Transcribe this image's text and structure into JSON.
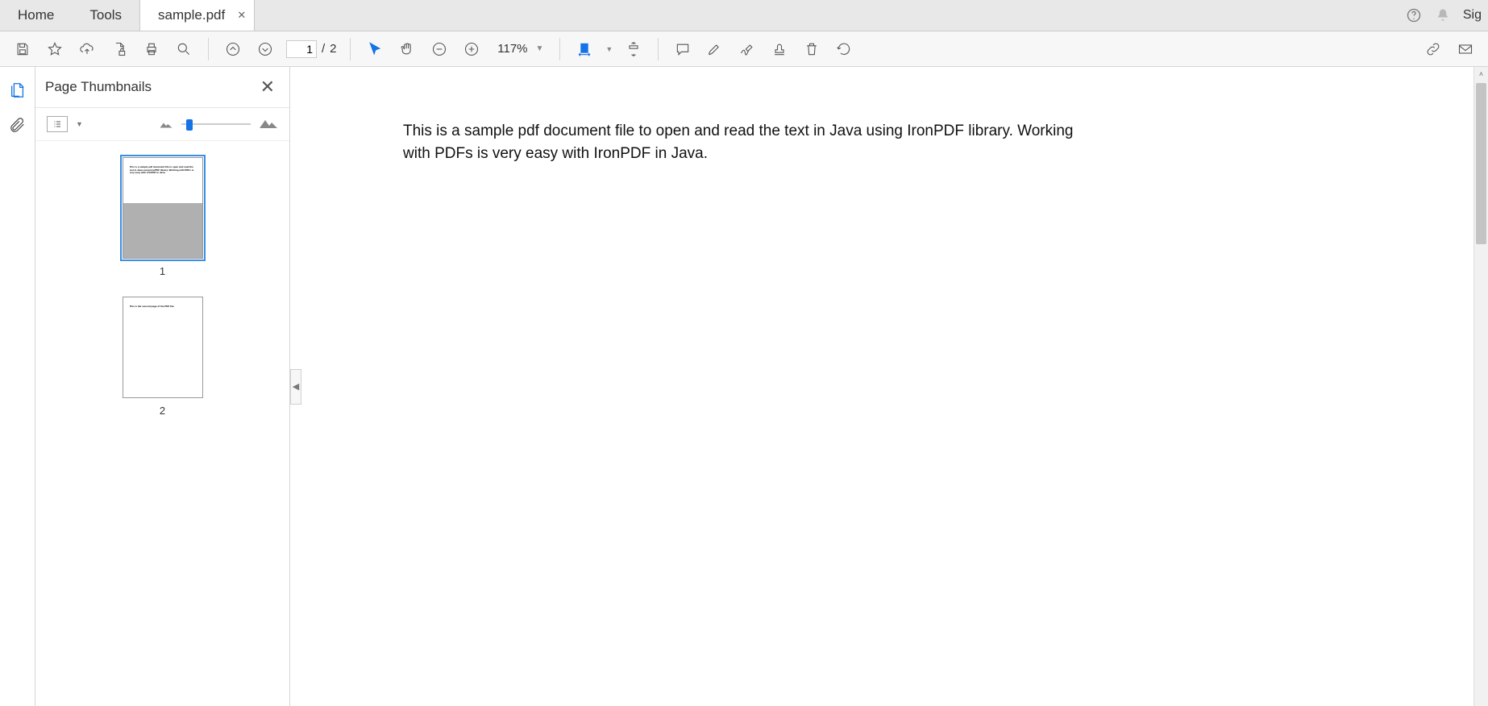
{
  "tabs": {
    "home": "Home",
    "tools": "Tools",
    "doc_name": "sample.pdf"
  },
  "header_right": {
    "sign": "Sig"
  },
  "paging": {
    "current": "1",
    "sep": "/",
    "total": "2"
  },
  "zoom": {
    "value": "117%"
  },
  "thumbpanel": {
    "title": "Page Thumbnails",
    "pages": [
      "1",
      "2"
    ]
  },
  "document": {
    "body": "This is a sample pdf document file to open and read the text in Java using IronPDF library. Working with PDFs is very easy with IronPDF in Java."
  }
}
